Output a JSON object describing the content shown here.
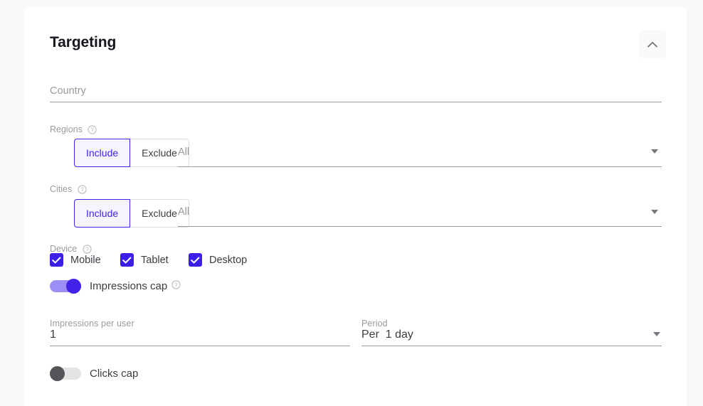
{
  "header": {
    "title": "Targeting",
    "collapse_icon": "chevron-up-icon"
  },
  "country": {
    "placeholder": "Country",
    "value": ""
  },
  "regions": {
    "label": "Regions",
    "help_icon": "help-circle-icon",
    "include_label": "Include",
    "exclude_label": "Exclude",
    "selected_mode": "Include",
    "select_placeholder": "All",
    "caret_icon": "chevron-down-icon"
  },
  "cities": {
    "label": "Cities",
    "help_icon": "help-circle-icon",
    "include_label": "Include",
    "exclude_label": "Exclude",
    "selected_mode": "Include",
    "select_placeholder": "All",
    "caret_icon": "chevron-down-icon"
  },
  "device": {
    "label": "Device",
    "help_icon": "help-circle-icon",
    "options": [
      {
        "label": "Mobile",
        "checked": true,
        "icon": "checkmark-icon"
      },
      {
        "label": "Tablet",
        "checked": true,
        "icon": "checkmark-icon"
      },
      {
        "label": "Desktop",
        "checked": true,
        "icon": "checkmark-icon"
      }
    ]
  },
  "impressions_cap": {
    "label": "Impressions cap",
    "help_icon": "help-circle-icon",
    "enabled": true,
    "per_user": {
      "label": "Impressions per user",
      "value": "1"
    },
    "period": {
      "label": "Period",
      "value": "Per  1 day",
      "caret_icon": "chevron-down-icon"
    }
  },
  "clicks_cap": {
    "label": "Clicks cap",
    "enabled": false
  },
  "colors": {
    "accent": "#4321e8",
    "checkbox": "#3b1fe8",
    "accent_soft": "#9b8ef5",
    "accent_bg": "#f6f4ff",
    "muted_text": "#9a9a9f",
    "body_text": "#3c3c43",
    "page_bg": "#f8f8f9",
    "card_bg": "#ffffff"
  }
}
